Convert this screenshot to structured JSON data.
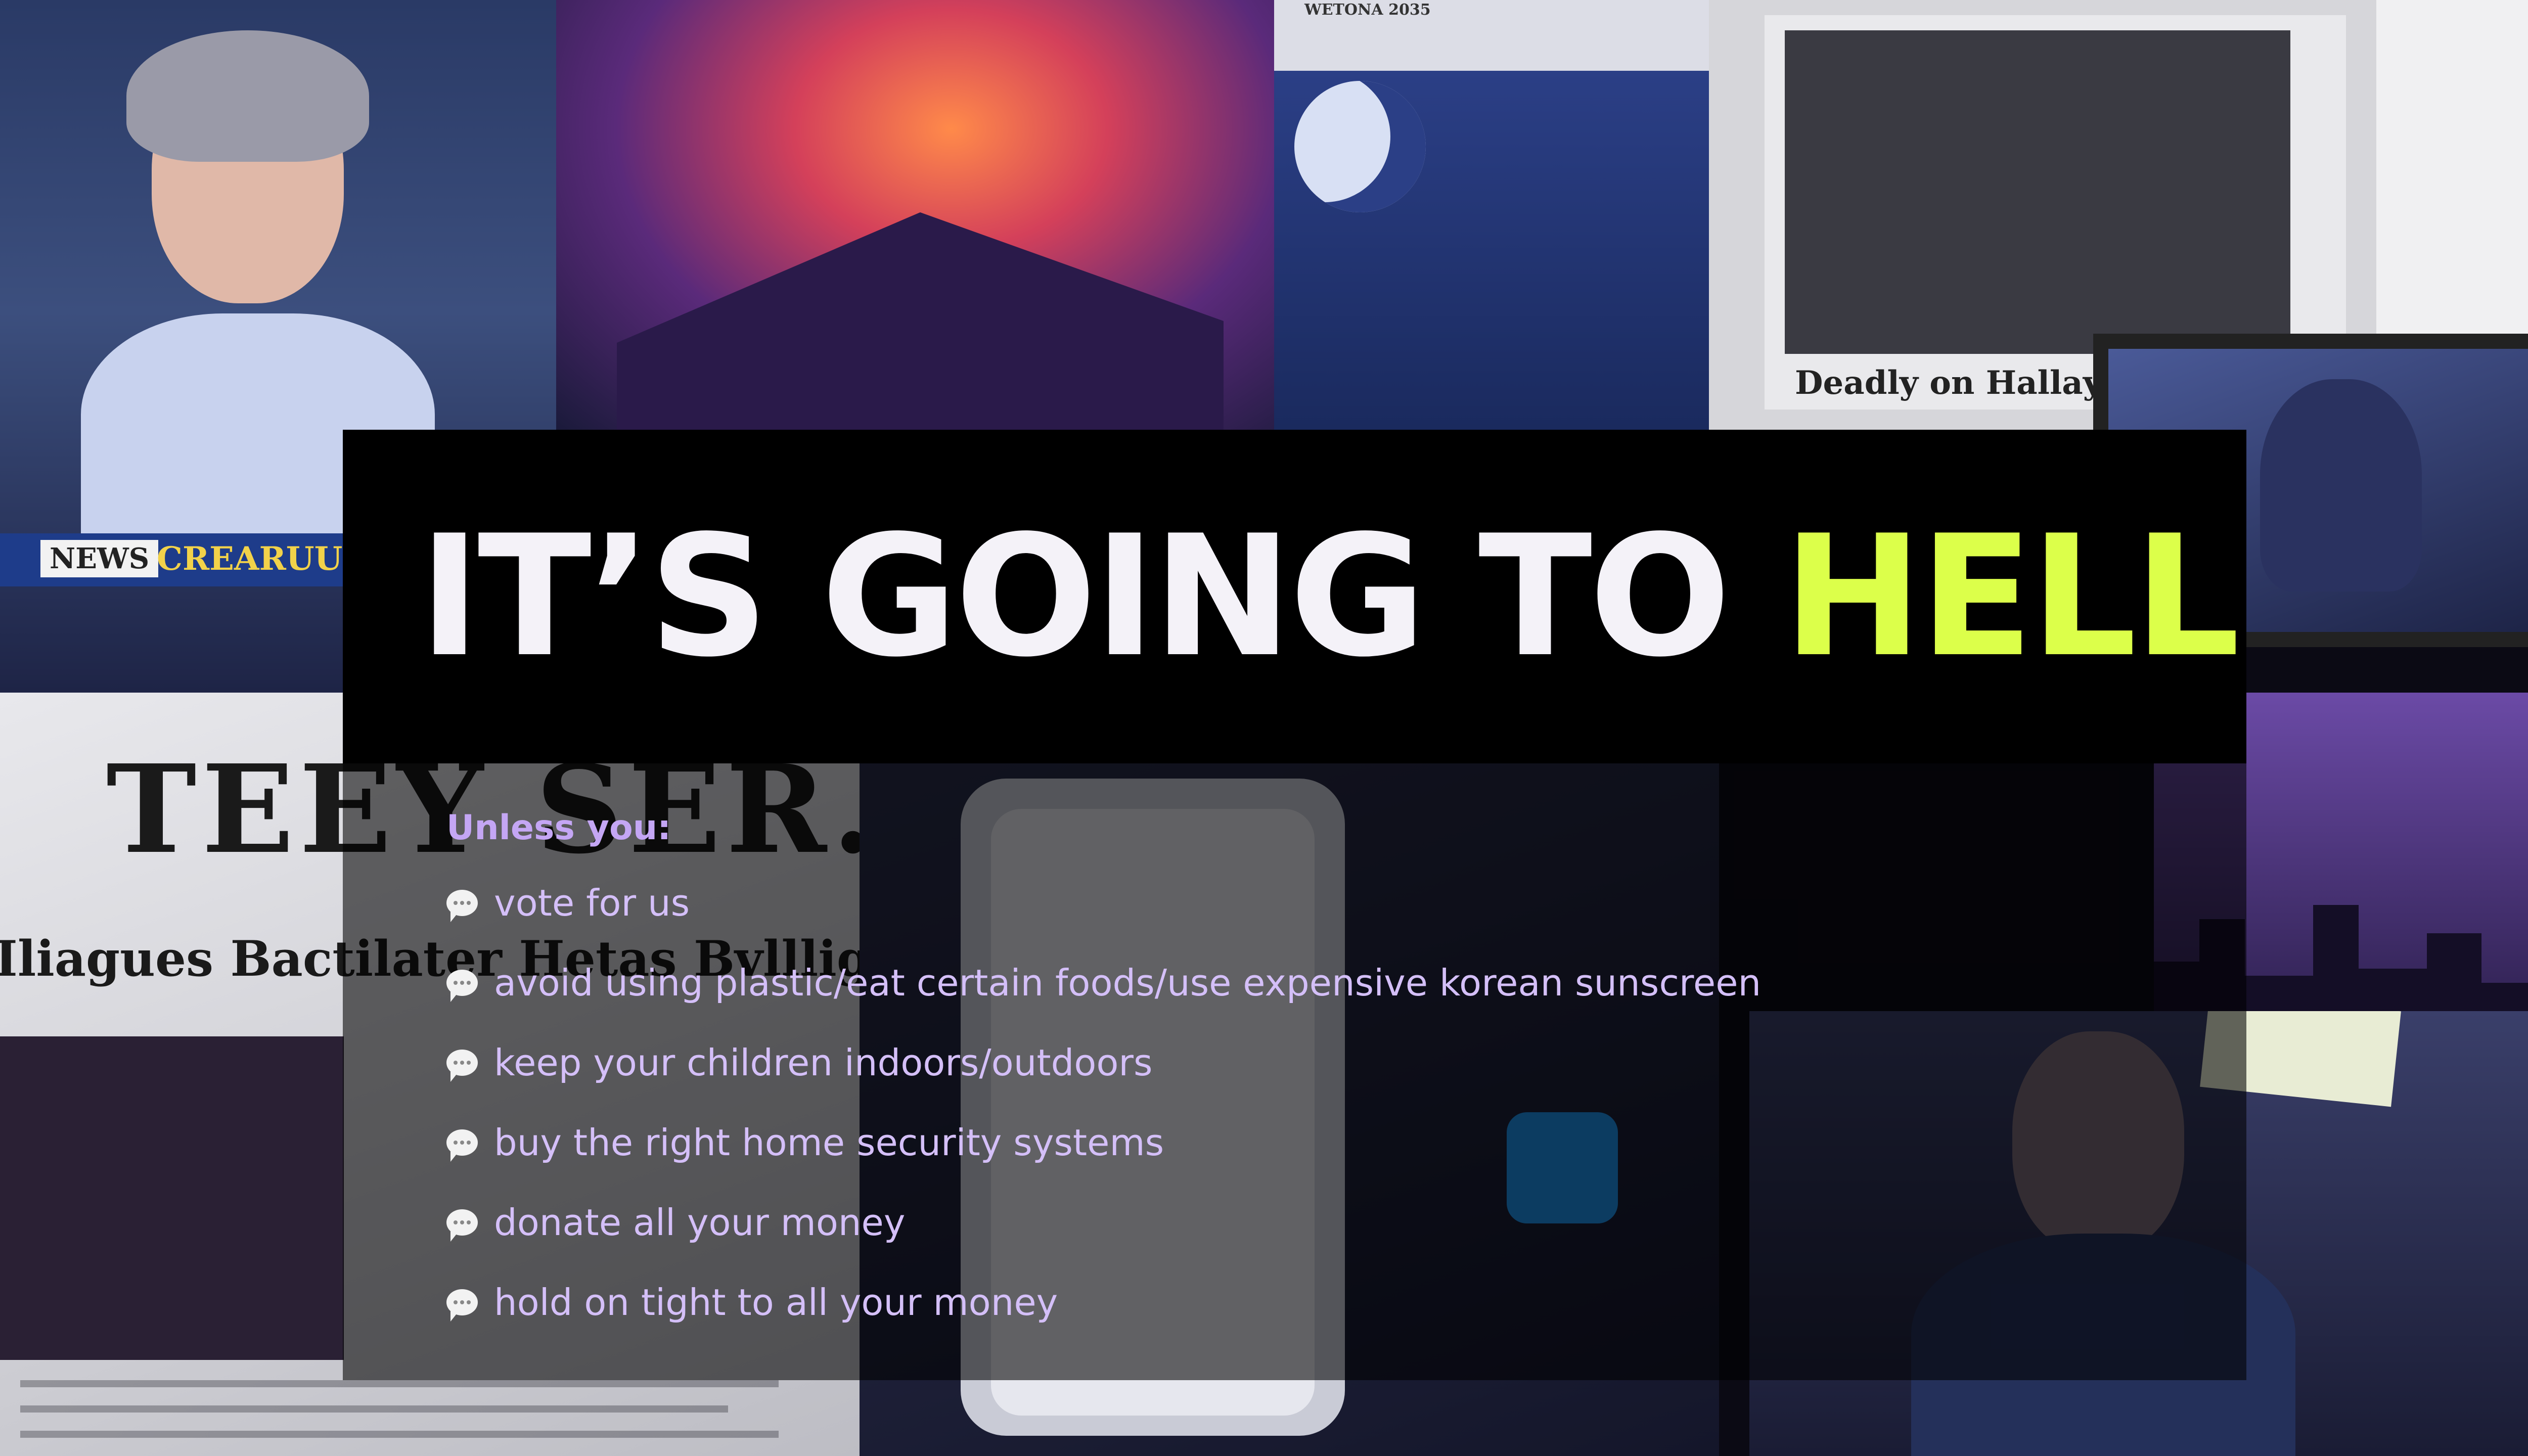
{
  "slide": {
    "title": "IT’S GOING TO",
    "title_accent": "HELL",
    "intro": "Unless you:",
    "items": [
      "vote for us",
      "avoid using plastic/eat certain foods/use expensive korean sunscreen",
      "keep your children indoors/outdoors",
      "buy the right home security systems",
      "donate all your money",
      "hold on tight to all your money"
    ],
    "item_icon": "speech-bubble-icon"
  },
  "background": {
    "ticker_badge": "NEWS",
    "ticker_name": "CREARUUS",
    "newspaper_masthead": "TEEY SER.NES",
    "newspaper_headline": "Deadly on Hallay",
    "newspaper_top": "WETONA 2035",
    "newspaper_sub": "Iliagues Bactilater Hetas Bvllligr Balies"
  },
  "colors": {
    "title_text": "#f4f2f8",
    "accent": "#dcff4a",
    "intro_text": "#c4a6f4",
    "item_text": "#d4bff8",
    "title_bar": "#000000"
  }
}
